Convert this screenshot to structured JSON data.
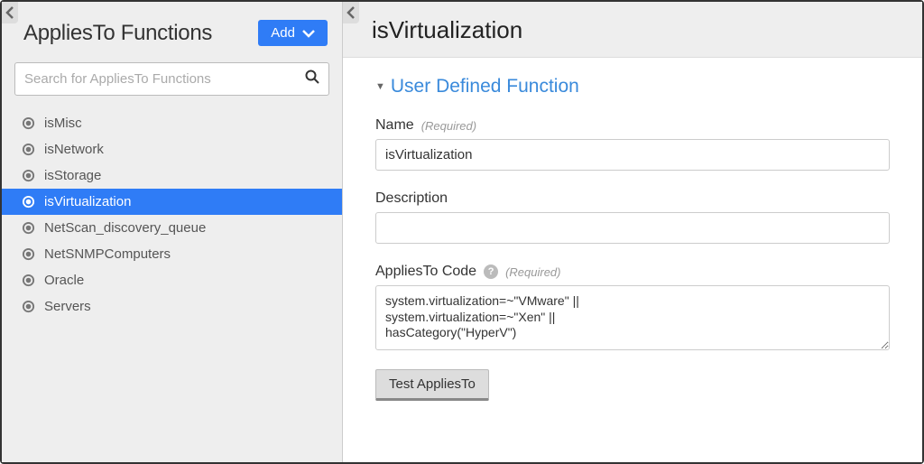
{
  "sidebar": {
    "title": "AppliesTo Functions",
    "add_button_label": "Add",
    "search_placeholder": "Search for AppliesTo Functions",
    "items": [
      {
        "label": "isMisc",
        "selected": false
      },
      {
        "label": "isNetwork",
        "selected": false
      },
      {
        "label": "isStorage",
        "selected": false
      },
      {
        "label": "isVirtualization",
        "selected": true
      },
      {
        "label": "NetScan_discovery_queue",
        "selected": false
      },
      {
        "label": "NetSNMPComputers",
        "selected": false
      },
      {
        "label": "Oracle",
        "selected": false
      },
      {
        "label": "Servers",
        "selected": false
      }
    ]
  },
  "detail": {
    "title": "isVirtualization",
    "section_title": "User Defined Function",
    "name_label": "Name",
    "required_text": "(Required)",
    "name_value": "isVirtualization",
    "description_label": "Description",
    "description_value": "",
    "code_label": "AppliesTo Code",
    "code_value": "system.virtualization=~\"VMware\" ||\nsystem.virtualization=~\"Xen\" ||\nhasCategory(\"HyperV\")",
    "test_button_label": "Test AppliesTo"
  }
}
